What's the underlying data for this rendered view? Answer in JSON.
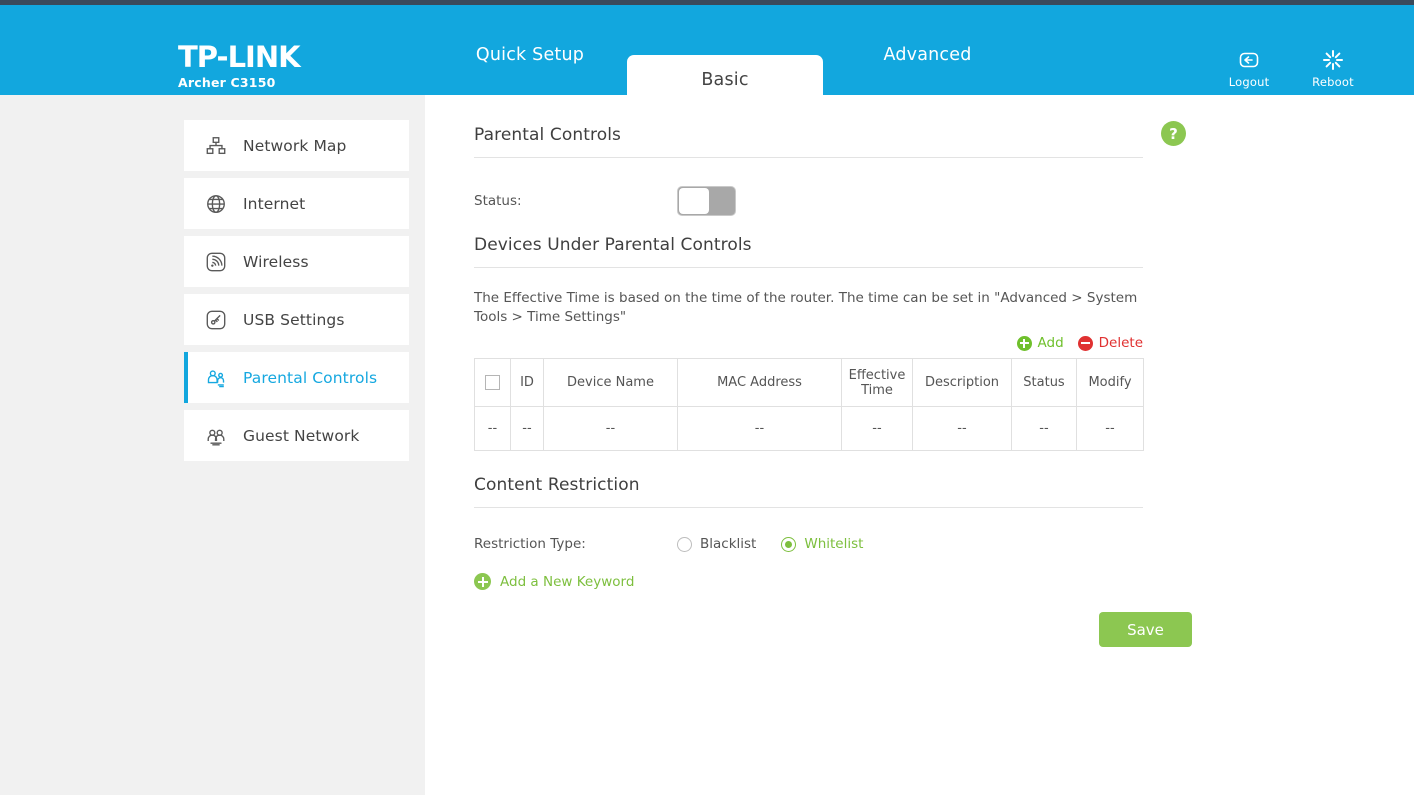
{
  "brand": {
    "name": "TP-LINK",
    "model": "Archer C3150"
  },
  "header": {
    "tabs": [
      {
        "label": "Quick Setup",
        "active": false
      },
      {
        "label": "Basic",
        "active": true
      },
      {
        "label": "Advanced",
        "active": false
      }
    ],
    "actions": [
      {
        "icon": "logout-icon",
        "label": "Logout"
      },
      {
        "icon": "reboot-icon",
        "label": "Reboot"
      }
    ]
  },
  "sidebar": {
    "items": [
      {
        "label": "Network Map",
        "icon": "network-map-icon",
        "active": false
      },
      {
        "label": "Internet",
        "icon": "globe-icon",
        "active": false
      },
      {
        "label": "Wireless",
        "icon": "wireless-icon",
        "active": false
      },
      {
        "label": "USB Settings",
        "icon": "usb-icon",
        "active": false
      },
      {
        "label": "Parental Controls",
        "icon": "parental-controls-icon",
        "active": true
      },
      {
        "label": "Guest Network",
        "icon": "guest-network-icon",
        "active": false
      }
    ]
  },
  "help": {
    "glyph": "?"
  },
  "parental_controls": {
    "section_title": "Parental Controls",
    "status_label": "Status:",
    "status_enabled": false
  },
  "devices": {
    "section_title": "Devices Under Parental Controls",
    "note": "The Effective Time is based on the time of the router. The time can be set in \"Advanced > System Tools > Time Settings\"",
    "add_label": "Add",
    "delete_label": "Delete",
    "columns": [
      "",
      "ID",
      "Device Name",
      "MAC Address",
      "Effective Time",
      "Description",
      "Status",
      "Modify"
    ],
    "rows": [
      [
        "--",
        "--",
        "--",
        "--",
        "--",
        "--",
        "--",
        "--"
      ]
    ]
  },
  "content_restriction": {
    "section_title": "Content Restriction",
    "type_label": "Restriction Type:",
    "options": [
      {
        "label": "Blacklist",
        "selected": false
      },
      {
        "label": "Whitelist",
        "selected": true
      }
    ],
    "add_keyword_label": "Add a New Keyword"
  },
  "footer": {
    "save_label": "Save"
  },
  "colors": {
    "header_blue": "#12a7de",
    "accent_blue": "#16a8e0",
    "green": "#8cc751",
    "green_text": "#7dbf3e",
    "red": "#e03131",
    "panel_gray": "#f1f1f1"
  }
}
